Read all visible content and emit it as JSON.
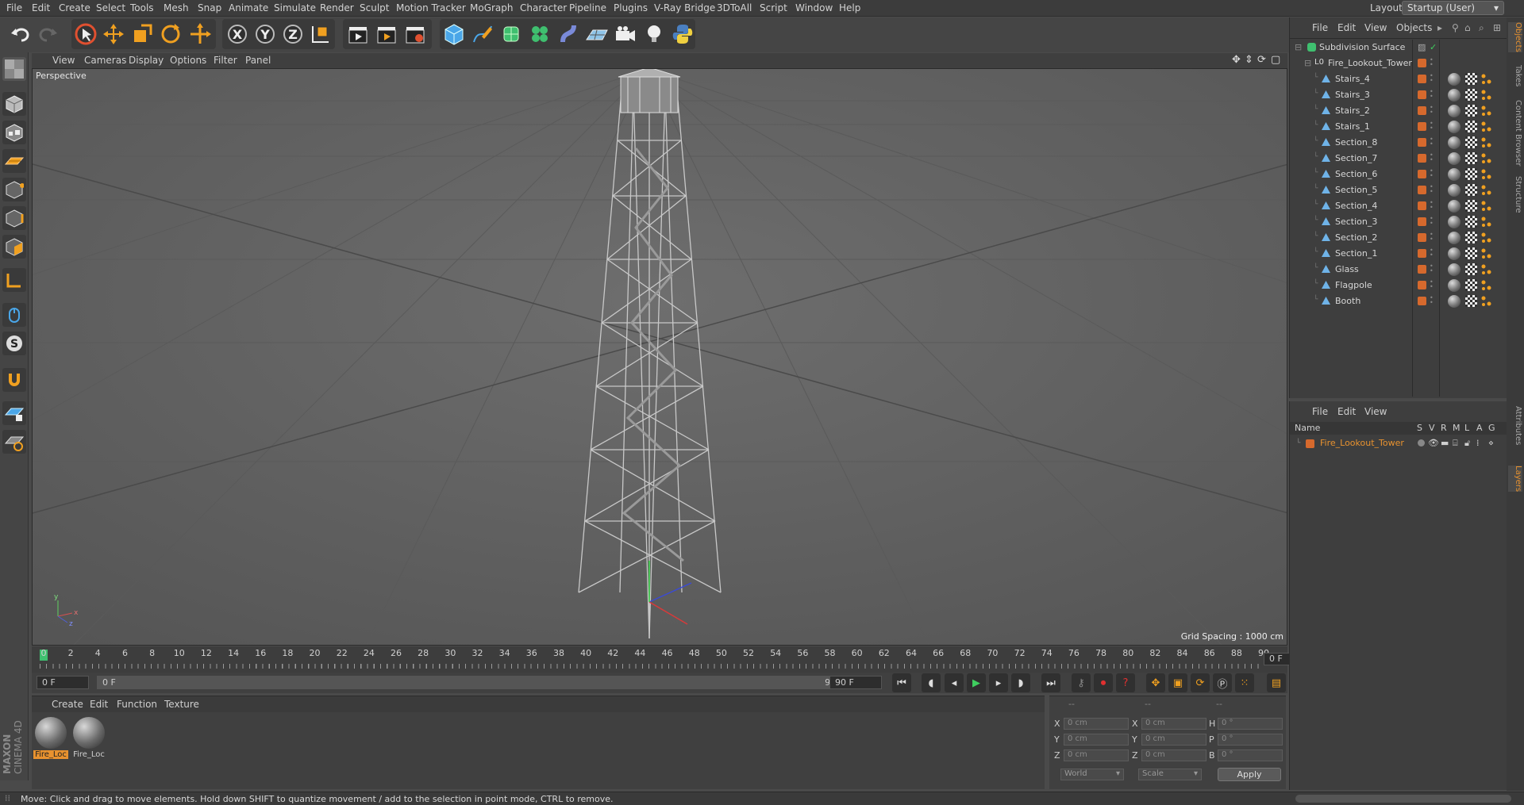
{
  "menubar": {
    "items": [
      "File",
      "Edit",
      "Create",
      "Select",
      "Tools",
      "Mesh",
      "Snap",
      "Animate",
      "Simulate",
      "Render",
      "Sculpt",
      "Motion Tracker",
      "MoGraph",
      "Character",
      "Pipeline",
      "Plugins",
      "V-Ray Bridge",
      "3DToAll",
      "Script",
      "Window",
      "Help"
    ],
    "layout_label": "Layout:",
    "layout_value": "Startup (User)"
  },
  "viewport": {
    "menu": [
      "View",
      "Cameras",
      "Display",
      "Options",
      "Filter",
      "Panel"
    ],
    "camera_label": "Perspective",
    "grid_spacing": "Grid Spacing : 1000 cm"
  },
  "timeline": {
    "ticks": [
      "0",
      "2",
      "4",
      "6",
      "8",
      "10",
      "12",
      "14",
      "16",
      "18",
      "20",
      "22",
      "24",
      "26",
      "28",
      "30",
      "32",
      "34",
      "36",
      "38",
      "40",
      "42",
      "44",
      "46",
      "48",
      "50",
      "52",
      "54",
      "56",
      "58",
      "60",
      "62",
      "64",
      "66",
      "68",
      "70",
      "72",
      "74",
      "76",
      "78",
      "80",
      "82",
      "84",
      "86",
      "88",
      "90"
    ],
    "current_frame": "0 F",
    "start_field": "0 F",
    "range_start": "0 F",
    "range_end": "90 F",
    "end_field": "90 F"
  },
  "materials": {
    "menu": [
      "Create",
      "Edit",
      "Function",
      "Texture"
    ],
    "items": [
      {
        "name": "Fire_Loc"
      },
      {
        "name": "Fire_Loc"
      }
    ]
  },
  "coords": {
    "header": [
      "--",
      "--",
      "--"
    ],
    "rows": [
      {
        "a": "X",
        "av": "0 cm",
        "b": "X",
        "bv": "0 cm",
        "c": "H",
        "cv": "0 °"
      },
      {
        "a": "Y",
        "av": "0 cm",
        "b": "Y",
        "bv": "0 cm",
        "c": "P",
        "cv": "0 °"
      },
      {
        "a": "Z",
        "av": "0 cm",
        "b": "Z",
        "bv": "0 cm",
        "c": "B",
        "cv": "0 °"
      }
    ],
    "mode_select": "World",
    "scale_select": "Scale",
    "apply": "Apply"
  },
  "objects": {
    "menu": [
      "File",
      "Edit",
      "View",
      "Objects"
    ],
    "root": "Subdivision Surface",
    "group": "Fire_Lookout_Tower",
    "children": [
      "Stairs_4",
      "Stairs_3",
      "Stairs_2",
      "Stairs_1",
      "Section_8",
      "Section_7",
      "Section_6",
      "Section_5",
      "Section_4",
      "Section_3",
      "Section_2",
      "Section_1",
      "Glass",
      "Flagpole",
      "Booth"
    ]
  },
  "layers": {
    "menu": [
      "File",
      "Edit",
      "View"
    ],
    "columns": [
      "Name",
      "S",
      "V",
      "R",
      "M",
      "L",
      "A",
      "G"
    ],
    "items": [
      "Fire_Lookout_Tower"
    ],
    "accent": "#e8922f"
  },
  "sidetabs": [
    "Objects",
    "Takes",
    "Content Browser",
    "Structure",
    "Attributes",
    "Layers"
  ],
  "status": "Move: Click and drag to move elements. Hold down SHIFT to quantize movement / add to the selection in point mode, CTRL to remove.",
  "brand": {
    "line1": "MAXON",
    "line2": "CINEMA 4D"
  },
  "colors": {
    "accent": "#d6692d",
    "selection": "#e8922f",
    "viewport_bg": "#656565"
  }
}
